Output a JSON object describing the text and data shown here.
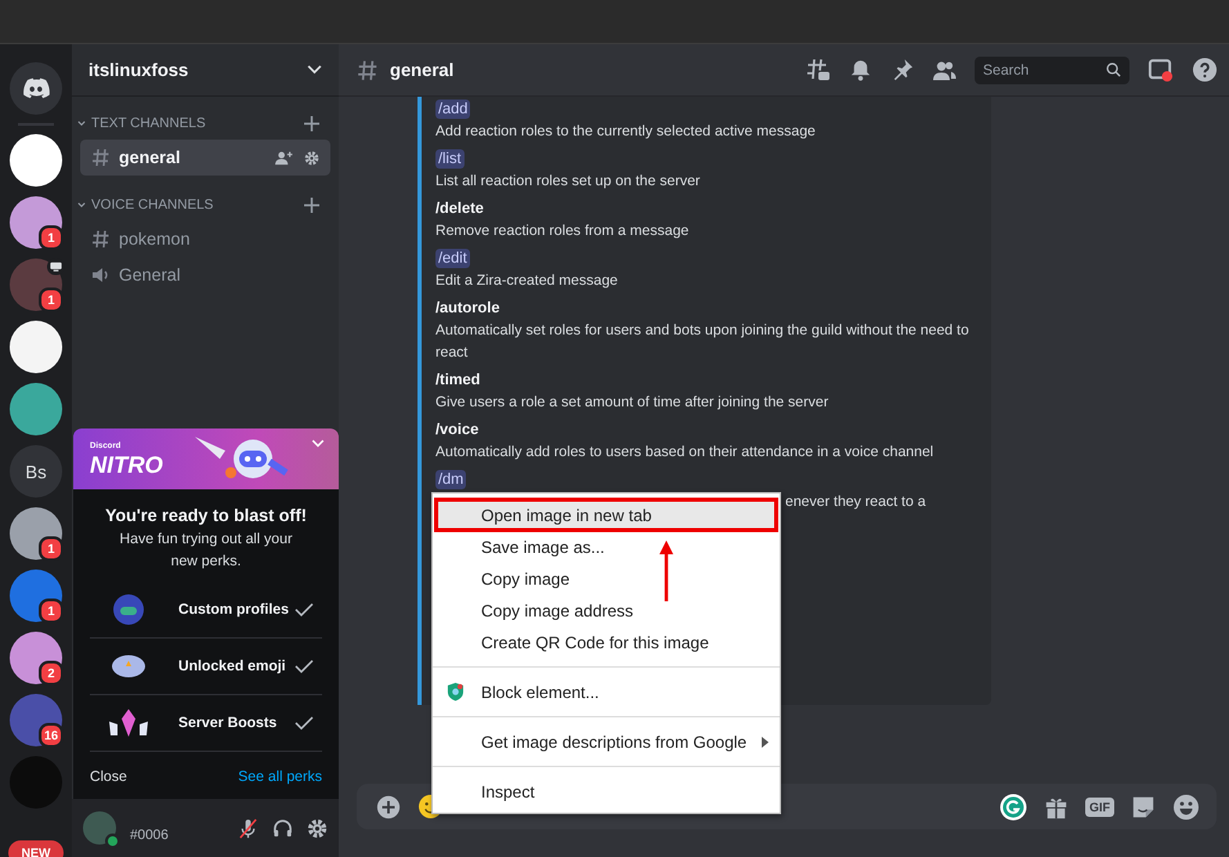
{
  "servers": [
    {
      "kind": "home",
      "color": "#313338"
    },
    {
      "kind": "picture",
      "color": "#ffffff"
    },
    {
      "kind": "picture",
      "color": "#c49ad8",
      "badge": "1"
    },
    {
      "kind": "picture",
      "color": "#5b3b40",
      "badge": "1",
      "streaming": true
    },
    {
      "kind": "picture",
      "color": "#f4f4f4"
    },
    {
      "kind": "picture",
      "color": "#3aa89c"
    },
    {
      "kind": "initials",
      "color": "#313338",
      "label": "Bs"
    },
    {
      "kind": "picture",
      "color": "#9aa0aa",
      "badge": "1"
    },
    {
      "kind": "picture",
      "color": "#1f6fe0",
      "badge": "1"
    },
    {
      "kind": "picture",
      "color": "#c890d8",
      "badge": "2"
    },
    {
      "kind": "picture",
      "color": "#4a4fa8",
      "badge": "16"
    },
    {
      "kind": "picture",
      "color": "#0c0c0c"
    },
    {
      "kind": "new",
      "color": "#da373c",
      "label": "NEW"
    }
  ],
  "sidebar": {
    "server_name": "itslinuxfoss",
    "categories": [
      {
        "name": "TEXT CHANNELS",
        "channels": [
          {
            "name": "general",
            "kind": "text",
            "selected": true
          }
        ]
      },
      {
        "name": "VOICE CHANNELS",
        "channels": [
          {
            "name": "pokemon",
            "kind": "text",
            "selected": false
          },
          {
            "name": "General",
            "kind": "voice",
            "selected": false
          }
        ]
      }
    ]
  },
  "nitro": {
    "brand": "Discord",
    "logo": "NITRO",
    "title": "You're ready to blast off!",
    "subtitle": "Have fun trying out all your new perks.",
    "perks": [
      {
        "label": "Custom profiles",
        "kind": "profile",
        "checked": true
      },
      {
        "label": "Unlocked emoji",
        "kind": "emoji",
        "checked": true
      },
      {
        "label": "Server Boosts",
        "kind": "boost",
        "checked": true
      }
    ],
    "close": "Close",
    "see_all": "See all perks"
  },
  "user": {
    "tag": "#0006",
    "muted": true
  },
  "header": {
    "channel": "general",
    "search_placeholder": "Search"
  },
  "commands": [
    {
      "name": "/add",
      "code": true,
      "description": "Add reaction roles to the currently selected active message"
    },
    {
      "name": "/list",
      "code": true,
      "description": "List all reaction roles set up on the server"
    },
    {
      "name": "/delete",
      "code": false,
      "description": "Remove reaction roles from a message"
    },
    {
      "name": "/edit",
      "code": true,
      "description": "Edit a Zira-created message"
    },
    {
      "name": "/autorole",
      "code": false,
      "description": "Automatically set roles for users and bots upon joining the guild without the need to react"
    },
    {
      "name": "/timed",
      "code": false,
      "description": "Give users a role a set amount of time after joining the server"
    },
    {
      "name": "/voice",
      "code": false,
      "description": "Automatically add roles to users based on their attendance in a voice channel"
    },
    {
      "name": "/dm",
      "code": true,
      "description": "enever they react to a",
      "covered": true
    }
  ],
  "context_menu": [
    {
      "kind": "item",
      "label": "Open image in new tab",
      "highlighted": true,
      "submenu": false
    },
    {
      "kind": "item",
      "label": "Save image as...",
      "highlighted": false,
      "submenu": false
    },
    {
      "kind": "item",
      "label": "Copy image",
      "highlighted": false,
      "submenu": false
    },
    {
      "kind": "item",
      "label": "Copy image address",
      "highlighted": false,
      "submenu": false
    },
    {
      "kind": "item",
      "label": "Create QR Code for this image",
      "highlighted": false,
      "submenu": false
    },
    {
      "kind": "separator"
    },
    {
      "kind": "extension",
      "label": "Block element...",
      "highlighted": false,
      "submenu": false
    },
    {
      "kind": "separator"
    },
    {
      "kind": "item",
      "label": "Get image descriptions from Google",
      "highlighted": false,
      "submenu": true
    },
    {
      "kind": "separator"
    },
    {
      "kind": "item",
      "label": "Inspect",
      "highlighted": false,
      "submenu": false
    }
  ],
  "composer": {
    "gif": "GIF"
  }
}
